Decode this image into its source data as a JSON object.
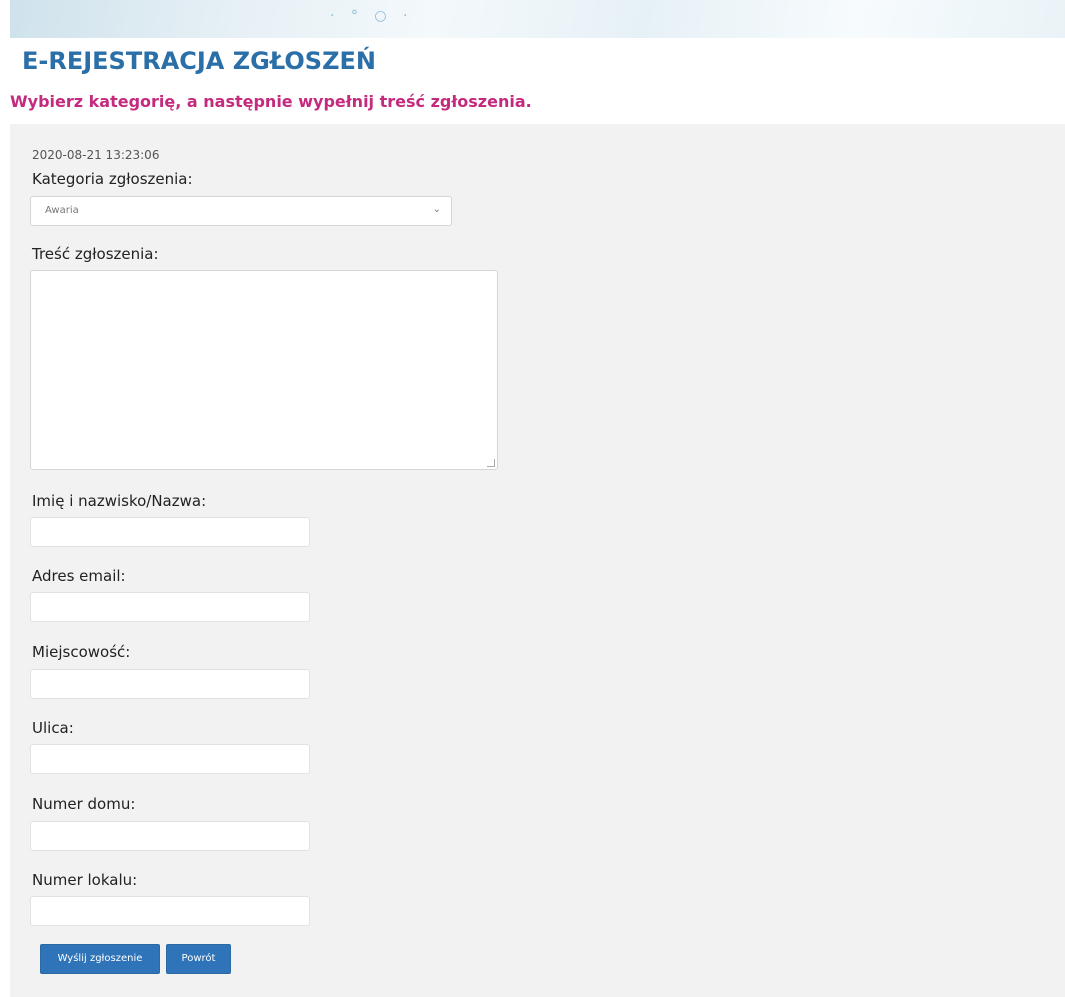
{
  "header": {
    "title": "E-REJESTRACJA ZGŁOSZEŃ",
    "subtitle": "Wybierz kategorię, a następnie wypełnij treść zgłoszenia."
  },
  "form": {
    "timestamp": "2020-08-21 13:23:06",
    "category_label": "Kategoria zgłoszenia:",
    "category_value": "Awaria",
    "content_label": "Treść zgłoszenia:",
    "name_label": "Imię i nazwisko/Nazwa:",
    "email_label": "Adres email:",
    "city_label": "Miejscowość:",
    "street_label": "Ulica:",
    "house_label": "Numer domu:",
    "apartment_label": "Numer lokalu:",
    "submit_label": "Wyślij zgłoszenie",
    "back_label": "Powrót"
  },
  "colors": {
    "title": "#2b6fa8",
    "subtitle": "#c42a7d",
    "button": "#2f74b8",
    "panel": "#f2f2f2"
  },
  "icons": {
    "dropdown": "chevron-down-icon"
  }
}
